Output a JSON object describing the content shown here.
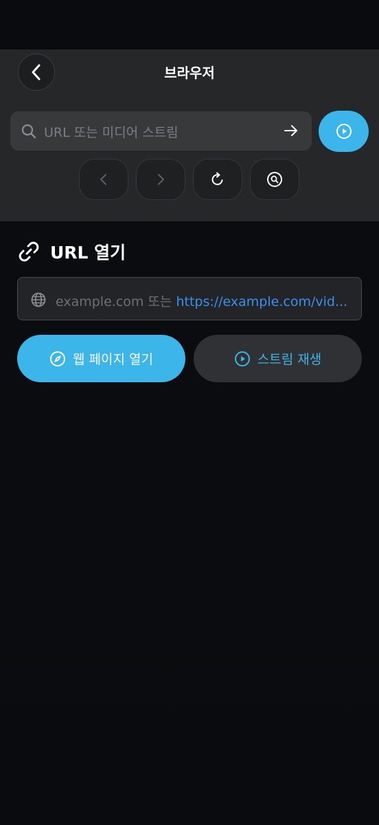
{
  "header": {
    "title": "브라우저",
    "back_icon": "chevron-left-icon"
  },
  "search": {
    "placeholder": "URL 또는 미디어 스트림",
    "search_icon": "search-icon",
    "go_icon": "arrow-right-icon",
    "play_icon": "play-circle-icon"
  },
  "nav": {
    "buttons": [
      {
        "name": "back",
        "icon": "chevron-left-icon",
        "enabled": false
      },
      {
        "name": "forward",
        "icon": "chevron-right-icon",
        "enabled": false
      },
      {
        "name": "reload",
        "icon": "reload-icon",
        "enabled": true
      },
      {
        "name": "search",
        "icon": "search-circle-icon",
        "enabled": true
      }
    ]
  },
  "open_url": {
    "section_title": "URL 열기",
    "section_icon": "link-icon",
    "input_placeholder_prefix": "example.com 또는",
    "input_placeholder_link": "https://example.com/vid...",
    "primary_button": "웹 페이지 열기",
    "primary_icon": "compass-icon",
    "secondary_button": "스트림 재생",
    "secondary_icon": "play-circle-icon"
  },
  "colors": {
    "accent": "#3cb5ea",
    "link": "#3b8ff0",
    "panel": "#262729",
    "background": "#0b0d10"
  }
}
